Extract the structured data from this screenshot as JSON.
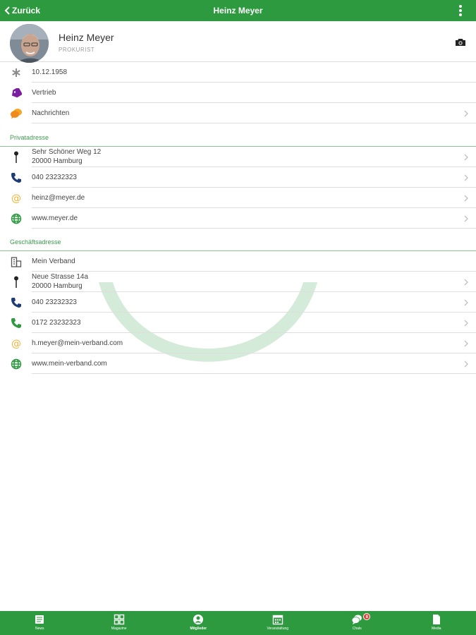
{
  "header": {
    "back_label": "Zurück",
    "title": "Heinz Meyer",
    "bar_color": "#2e9a3f"
  },
  "profile": {
    "name": "Heinz Meyer",
    "role": "PROKURIST"
  },
  "details": {
    "birthday": "10.12.1958",
    "department": "Vertrieb",
    "messages": "Nachrichten"
  },
  "private": {
    "section_label": "Privatadresse",
    "street": "Sehr Schöner Weg 12",
    "city": "20000 Hamburg",
    "phone": "040 23232323",
    "email": "heinz@meyer.de",
    "web": "www.meyer.de"
  },
  "business": {
    "section_label": "Geschäftsadresse",
    "company": "Mein Verband",
    "street": "Neue Strasse 14a",
    "city": "20000 Hamburg",
    "phone": "040 23232323",
    "mobile": "0172 23232323",
    "email": "h.meyer@mein-verband.com",
    "web": "www.mein-verband.com"
  },
  "tabs": [
    {
      "label": "News",
      "icon": "news-icon"
    },
    {
      "label": "Magazine",
      "icon": "grid-icon"
    },
    {
      "label": "Mitglieder",
      "icon": "person-icon"
    },
    {
      "label": "Veranstaltung",
      "icon": "calendar-icon"
    },
    {
      "label": "Chats",
      "icon": "chat-icon",
      "badge": "8"
    },
    {
      "label": "Media",
      "icon": "file-icon"
    }
  ],
  "colors": {
    "accent": "#2e9a3f",
    "section_text": "#3f9b4f",
    "tag": "#7b1fa2",
    "chat": "#ef8a1c",
    "phone": "#1e3c72",
    "mobile": "#2e9a3f",
    "email": "#f2b233",
    "web": "#2e9a3f",
    "badge": "#e53935"
  }
}
